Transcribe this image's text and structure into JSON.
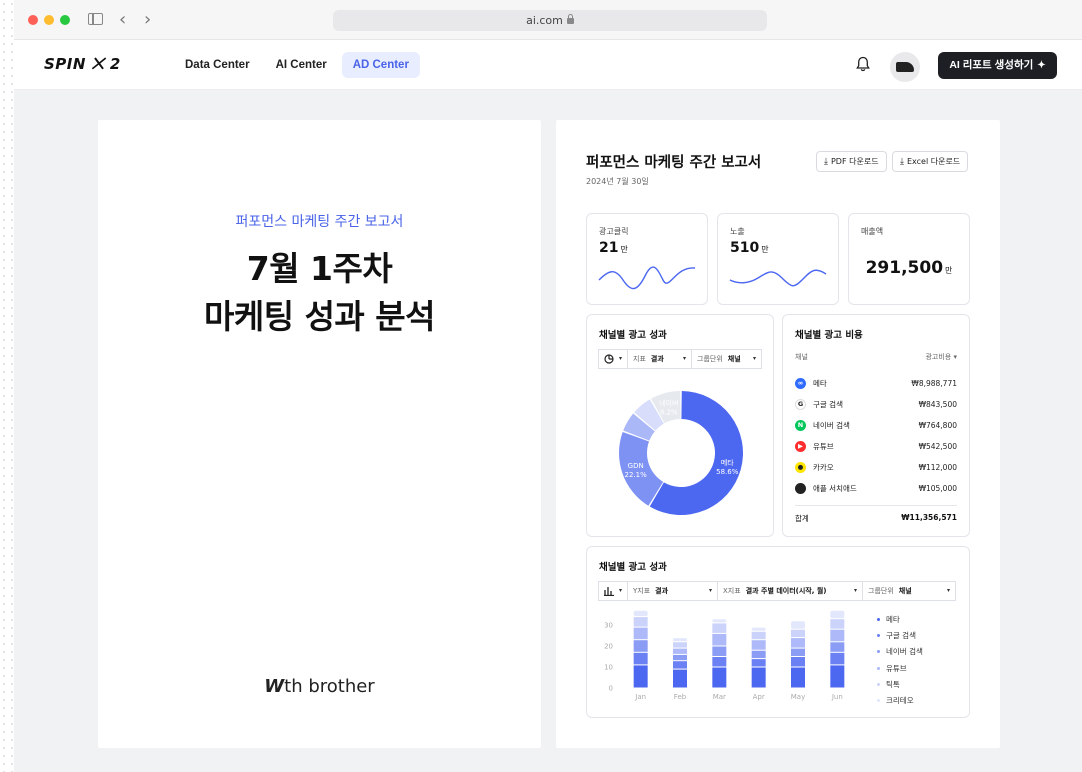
{
  "browser": {
    "url": "ai.com"
  },
  "header": {
    "logo": "SPIN ⨉ 2",
    "tabs": [
      {
        "label": "Data Center"
      },
      {
        "label": "AI Center"
      },
      {
        "label": "AD Center",
        "active": true
      }
    ],
    "ai_button": "AI 리포트 생성하기"
  },
  "cover": {
    "subtitle": "퍼포먼스 마케팅 주간 보고서",
    "title_line1": "7월 1주차",
    "title_line2": "마케팅 성과 분석",
    "brand_mark": "W",
    "brand_text": "th brother"
  },
  "report": {
    "title": "퍼포먼스 마케팅 주간 보고서",
    "date": "2024년 7월 30일",
    "pdf_button": "PDF 다운로드",
    "excel_button": "Excel 다운로드",
    "kpis": [
      {
        "label": "광고클릭",
        "value": "21",
        "unit": "만"
      },
      {
        "label": "노출",
        "value": "510",
        "unit": "만"
      },
      {
        "label": "매출액",
        "value": "291,500",
        "unit": "만"
      }
    ],
    "donut_card": {
      "title": "채널별 광고 성과",
      "metric_label": "지표",
      "metric_value": "결과",
      "group_label": "그룹단위",
      "group_value": "채널"
    },
    "cost_card": {
      "title": "채널별 광고 비용",
      "col_channel": "채널",
      "col_cost": "광고비용",
      "rows": [
        {
          "channel": "메타",
          "cost": "₩8,988,771",
          "color": "#2f6bff",
          "icon_text": "∞"
        },
        {
          "channel": "구글 검색",
          "cost": "₩843,500",
          "color": "#ffffff",
          "icon_text": "G"
        },
        {
          "channel": "네이버 검색",
          "cost": "₩764,800",
          "color": "#03c75a",
          "icon_text": "N"
        },
        {
          "channel": "유튜브",
          "cost": "₩542,500",
          "color": "#ff2d2d",
          "icon_text": "▶"
        },
        {
          "channel": "카카오",
          "cost": "₩112,000",
          "color": "#fee500",
          "icon_text": "●"
        },
        {
          "channel": "애플 서치애드",
          "cost": "₩105,000",
          "color": "#222222",
          "icon_text": ""
        }
      ],
      "total_label": "합계",
      "total_value": "₩11,356,571"
    },
    "bar_card": {
      "title": "채널별 광고 성과",
      "y_label": "Y지표",
      "y_value": "결과",
      "x_label": "X지표",
      "x_value": "결과 주별 데이터(시작, 월)",
      "group_label": "그룹단위",
      "group_value": "채널"
    }
  },
  "colors": {
    "accent": "#4a63e7",
    "series": [
      "#4c67f0",
      "#6a80f3",
      "#8b9cf5",
      "#adb9f8",
      "#cbd3fa",
      "#e3e7fc"
    ]
  },
  "chart_data": [
    {
      "type": "pie",
      "categories": [
        "메타",
        "GDN",
        "",
        "",
        "네이버"
      ],
      "values": [
        58.6,
        22.1,
        5.5,
        5.6,
        8.2
      ],
      "slice_labels": [
        {
          "name": "메타",
          "pct": "58.6%"
        },
        {
          "name": "GDN",
          "pct": "22.1%"
        },
        {
          "name": "",
          "pct": ""
        },
        {
          "name": "",
          "pct": ""
        },
        {
          "name": "네이버",
          "pct": "8.2%"
        }
      ]
    },
    {
      "type": "bar",
      "stacked": true,
      "categories": [
        "Jan",
        "Feb",
        "Mar",
        "Apr",
        "May",
        "Jun"
      ],
      "yticks": [
        0,
        10,
        20,
        30
      ],
      "ylim": [
        0,
        40
      ],
      "legend_position": "right",
      "series": [
        {
          "name": "메타",
          "values": [
            11,
            9,
            10,
            10,
            10,
            11
          ]
        },
        {
          "name": "구글 검색",
          "values": [
            6,
            4,
            5,
            4,
            5,
            6
          ]
        },
        {
          "name": "네이버 검색",
          "values": [
            6,
            3,
            5,
            4,
            4,
            5
          ]
        },
        {
          "name": "유튜브",
          "values": [
            6,
            3,
            6,
            5,
            5,
            6
          ]
        },
        {
          "name": "틱톡",
          "values": [
            5,
            3,
            5,
            4,
            4,
            5
          ]
        },
        {
          "name": "크리테오",
          "values": [
            3,
            2,
            2,
            2,
            4,
            4
          ]
        }
      ]
    }
  ]
}
